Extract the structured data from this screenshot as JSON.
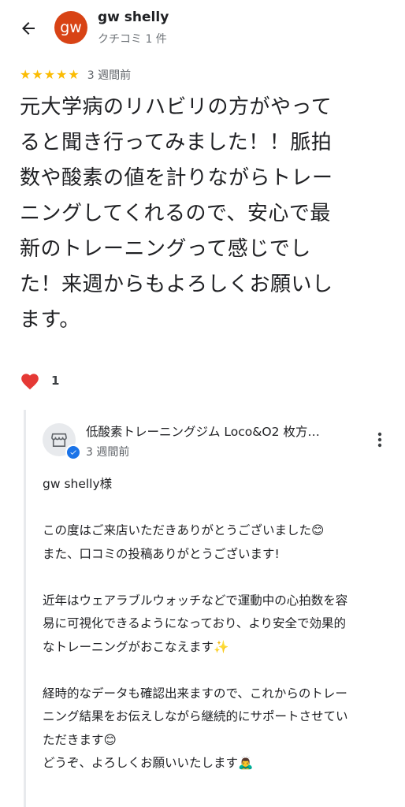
{
  "header": {
    "avatar_text": "gw",
    "reviewer_name": "gw shelly",
    "reviewer_meta": "クチコミ 1 件"
  },
  "review": {
    "rating": 5,
    "time": "3 週間前",
    "text_lines": [
      "元大学病のリハビリの方がやって",
      "ると聞き行ってみました！！脈拍",
      "数や酸素の値を計りながらトレー",
      "ニングしてくれるので、安心で最",
      "新のトレーニングって感じでし",
      "た！来週からもよろしくお願いし",
      "ます。"
    ],
    "like_count": "1"
  },
  "reply": {
    "owner_name": "低酸素トレーニングジム Loco&O2 枚方…",
    "time": "3 週間前",
    "lines": [
      "gw shelly様",
      "",
      "この度はご来店いただきありがとうございました😊",
      "また、口コミの投稿ありがとうございます!",
      "",
      "近年はウェアラブルウォッチなどで運動中の心拍数を容",
      "易に可視化できるようになっており、より安全で効果的",
      "なトレーニングがおこなえます✨",
      "",
      "経時的なデータも確認出来ますので、これからのトレー",
      "ニング結果をお伝えしながら継続的にサポートさせてい",
      "ただきます😊",
      "どうぞ、よろしくお願いいたします🙇‍♂️"
    ]
  },
  "colors": {
    "star": "#fbbc04",
    "avatar_bg": "#d84315",
    "heart": "#e53935",
    "verified": "#1a73e8"
  },
  "icons": [
    "back-arrow-icon",
    "star-icon",
    "heart-icon",
    "store-icon",
    "verified-check-icon",
    "more-vert-icon"
  ]
}
